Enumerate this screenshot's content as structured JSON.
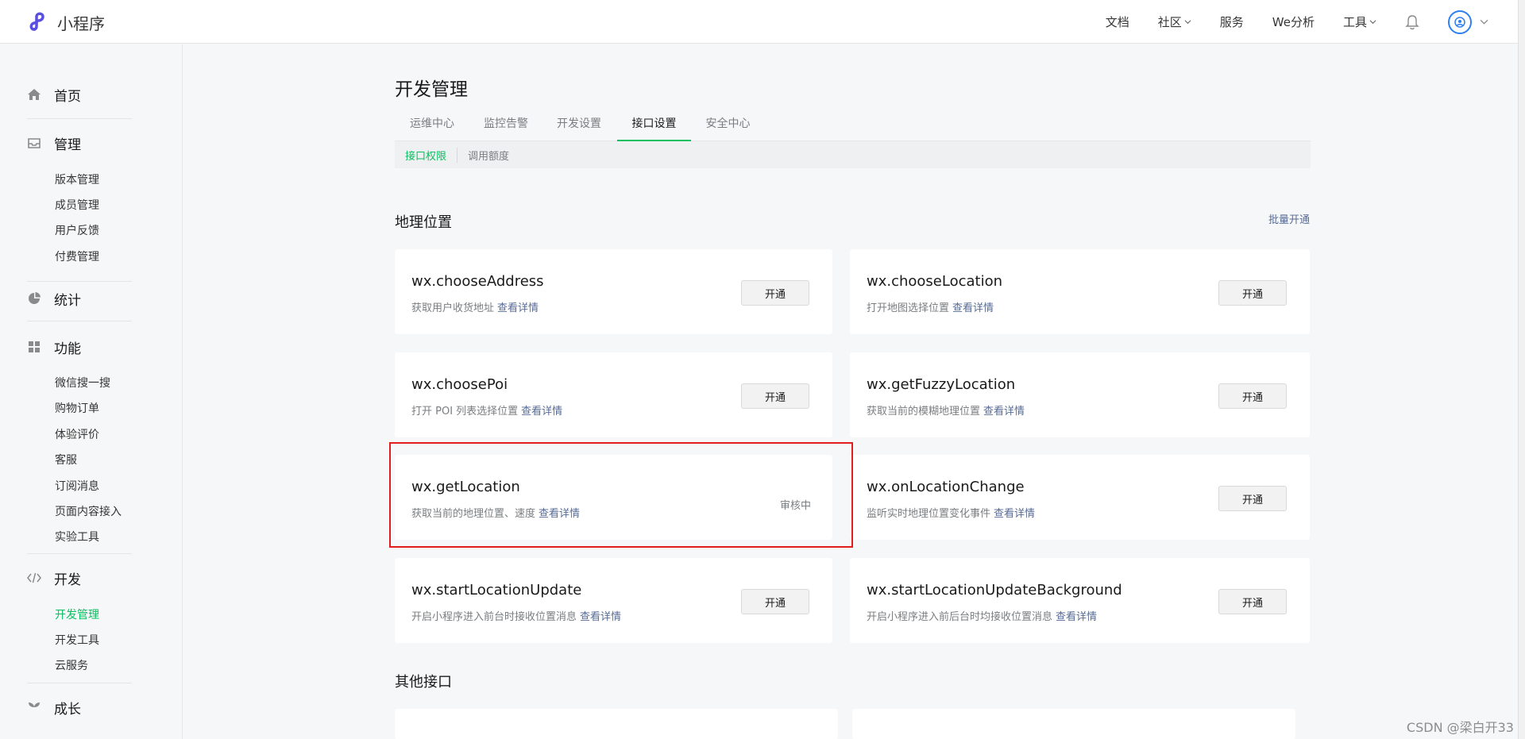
{
  "header": {
    "app_name": "小程序",
    "nav": [
      {
        "label": "文档",
        "has_dropdown": false
      },
      {
        "label": "社区",
        "has_dropdown": true
      },
      {
        "label": "服务",
        "has_dropdown": false
      },
      {
        "label": "We分析",
        "has_dropdown": false
      },
      {
        "label": "工具",
        "has_dropdown": true
      }
    ],
    "bell_icon": "bell-icon",
    "avatar_icon": "user-avatar-icon"
  },
  "sidebar": {
    "home": "首页",
    "manage": {
      "label": "管理",
      "items": [
        "版本管理",
        "成员管理",
        "用户反馈",
        "付费管理"
      ]
    },
    "stats": "统计",
    "features": {
      "label": "功能",
      "items": [
        "微信搜一搜",
        "购物订单",
        "体验评价",
        "客服",
        "订阅消息",
        "页面内容接入",
        "实验工具"
      ]
    },
    "dev": {
      "label": "开发",
      "items": [
        "开发管理",
        "开发工具",
        "云服务"
      ],
      "active": "开发管理"
    },
    "growth": "成长"
  },
  "main": {
    "title": "开发管理",
    "tabs": [
      "运维中心",
      "监控告警",
      "开发设置",
      "接口设置",
      "安全中心"
    ],
    "active_tab": "接口设置",
    "subtabs": [
      "接口权限",
      "调用额度"
    ],
    "active_subtab": "接口权限",
    "section1": {
      "title": "地理位置",
      "action": "批量开通",
      "link_text": "查看详情",
      "cards": [
        {
          "name": "wx.chooseAddress",
          "desc": "获取用户收货地址",
          "action": "开通"
        },
        {
          "name": "wx.chooseLocation",
          "desc": "打开地图选择位置",
          "action": "开通"
        },
        {
          "name": "wx.choosePoi",
          "desc": "打开 POI 列表选择位置",
          "action": "开通"
        },
        {
          "name": "wx.getFuzzyLocation",
          "desc": "获取当前的模糊地理位置",
          "action": "开通"
        },
        {
          "name": "wx.getLocation",
          "desc": "获取当前的地理位置、速度",
          "status": "审核中"
        },
        {
          "name": "wx.onLocationChange",
          "desc": "监听实时地理位置变化事件",
          "action": "开通"
        },
        {
          "name": "wx.startLocationUpdate",
          "desc": "开启小程序进入前台时接收位置消息",
          "action": "开通"
        },
        {
          "name": "wx.startLocationUpdateBackground",
          "desc": "开启小程序进入前后台时均接收位置消息",
          "action": "开通"
        }
      ]
    },
    "section2": {
      "title": "其他接口"
    }
  },
  "watermark": "CSDN @梁白开33",
  "colors": {
    "accent": "#07c160",
    "link": "#576b95",
    "highlight": "#e21d1d"
  }
}
